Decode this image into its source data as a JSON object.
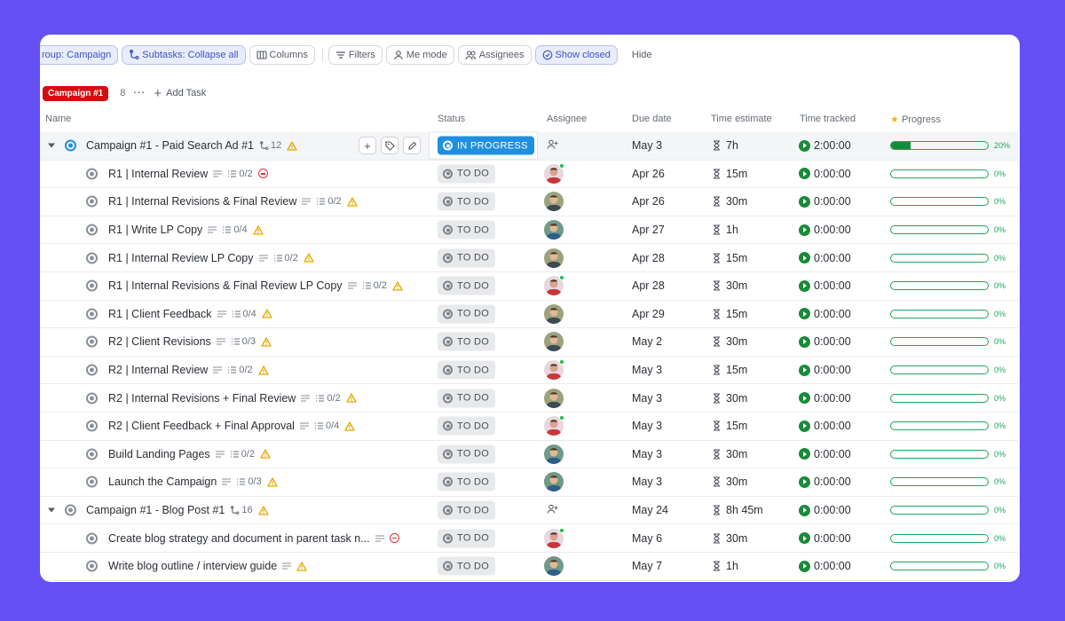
{
  "toolbar": {
    "group_label": "roup: Campaign",
    "subtasks_label": "Subtasks: Collapse all",
    "columns_label": "Columns",
    "filters_label": "Filters",
    "me_mode_label": "Me mode",
    "assignees_label": "Assignees",
    "show_closed_label": "Show closed",
    "hide_label": "Hide"
  },
  "group": {
    "name": "Campaign #1",
    "count": "8",
    "more": "···",
    "add_task": "Add Task",
    "color": "#d20f0f"
  },
  "columns": {
    "name": "Name",
    "status": "Status",
    "assignee": "Assignee",
    "due": "Due date",
    "estimate": "Time estimate",
    "tracked": "Time tracked",
    "progress": "Progress"
  },
  "rows": [
    {
      "name": "Campaign #1 - Paid Search Ad #1",
      "subtasks": "12",
      "status": "IN PROGRESS",
      "due": "May 3",
      "estimate": "7h",
      "tracked": "2:00:00",
      "progress": 0.2,
      "pct": "20%"
    },
    {
      "name": "R1 | Internal Review",
      "checklist": "0/2",
      "status": "TO DO",
      "due": "Apr 26",
      "estimate": "15m",
      "tracked": "0:00:00",
      "progress": 0,
      "pct": "0%"
    },
    {
      "name": "R1 | Internal Revisions & Final Review",
      "checklist": "0/2",
      "status": "TO DO",
      "due": "Apr 26",
      "estimate": "30m",
      "tracked": "0:00:00",
      "progress": 0,
      "pct": "0%"
    },
    {
      "name": "R1 | Write LP Copy",
      "checklist": "0/4",
      "status": "TO DO",
      "due": "Apr 27",
      "estimate": "1h",
      "tracked": "0:00:00",
      "progress": 0,
      "pct": "0%"
    },
    {
      "name": "R1 | Internal Review LP Copy",
      "checklist": "0/2",
      "status": "TO DO",
      "due": "Apr 28",
      "estimate": "15m",
      "tracked": "0:00:00",
      "progress": 0,
      "pct": "0%"
    },
    {
      "name": "R1 | Internal Revisions & Final Review LP Copy",
      "checklist": "0/2",
      "status": "TO DO",
      "due": "Apr 28",
      "estimate": "30m",
      "tracked": "0:00:00",
      "progress": 0,
      "pct": "0%"
    },
    {
      "name": "R1 | Client Feedback",
      "checklist": "0/4",
      "status": "TO DO",
      "due": "Apr 29",
      "estimate": "15m",
      "tracked": "0:00:00",
      "progress": 0,
      "pct": "0%"
    },
    {
      "name": "R2 | Client Revisions",
      "checklist": "0/3",
      "status": "TO DO",
      "due": "May 2",
      "estimate": "30m",
      "tracked": "0:00:00",
      "progress": 0,
      "pct": "0%"
    },
    {
      "name": "R2 | Internal Review",
      "checklist": "0/2",
      "status": "TO DO",
      "due": "May 3",
      "estimate": "15m",
      "tracked": "0:00:00",
      "progress": 0,
      "pct": "0%"
    },
    {
      "name": "R2 | Internal Revisions + Final Review",
      "checklist": "0/2",
      "status": "TO DO",
      "due": "May 3",
      "estimate": "30m",
      "tracked": "0:00:00",
      "progress": 0,
      "pct": "0%"
    },
    {
      "name": "R2 | Client Feedback + Final Approval",
      "checklist": "0/4",
      "status": "TO DO",
      "due": "May 3",
      "estimate": "15m",
      "tracked": "0:00:00",
      "progress": 0,
      "pct": "0%"
    },
    {
      "name": "Build Landing Pages",
      "checklist": "0/2",
      "status": "TO DO",
      "due": "May 3",
      "estimate": "30m",
      "tracked": "0:00:00",
      "progress": 0,
      "pct": "0%"
    },
    {
      "name": "Launch the Campaign",
      "checklist": "0/3",
      "status": "TO DO",
      "due": "May 3",
      "estimate": "30m",
      "tracked": "0:00:00",
      "progress": 0,
      "pct": "0%"
    },
    {
      "name": "Campaign #1 - Blog Post #1",
      "subtasks": "16",
      "status": "TO DO",
      "due": "May 24",
      "estimate": "8h 45m",
      "tracked": "0:00:00",
      "progress": 0,
      "pct": "0%"
    },
    {
      "name": "Create blog strategy and document in parent task n...",
      "status": "TO DO",
      "due": "May 6",
      "estimate": "30m",
      "tracked": "0:00:00",
      "progress": 0,
      "pct": "0%"
    },
    {
      "name": "Write blog outline / interview guide",
      "status": "TO DO",
      "due": "May 7",
      "estimate": "1h",
      "tracked": "0:00:00",
      "progress": 0,
      "pct": "0%"
    }
  ]
}
